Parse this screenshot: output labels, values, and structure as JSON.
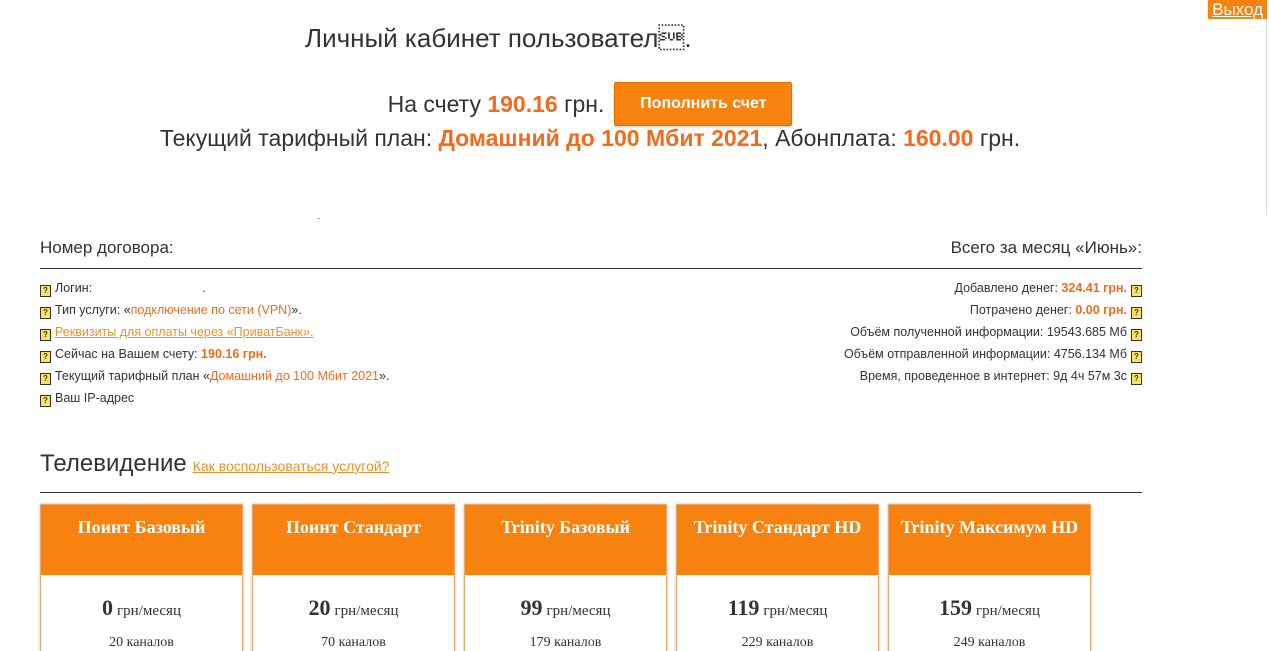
{
  "logout_label": "Выход",
  "header": {
    "title": "Личный кабинет пользовател\u001a.",
    "balance_prefix": "На счету",
    "balance_value": "190.16",
    "balance_unit": "грн.",
    "topup_label": "Пополнить счет",
    "plan_prefix": "Текущий тарифный план:",
    "plan_name": "Домашний до 100 Мбит 2021",
    "fee_prefix": ", Абонплата:",
    "fee_value": "160.00",
    "fee_unit": "грн."
  },
  "contract": {
    "heading_left": "Номер договора:",
    "heading_right": "Всего за месяц «Июнь»:",
    "left_rows": {
      "login_label": "Логин:",
      "login_value": ".",
      "service_label": "Тип услуги: «",
      "service_value": "подключение по сети (VPN)",
      "service_suffix": "».",
      "requisites_link": "Реквизиты для оплаты через «ПриватБанк».",
      "account_label": "Сейчас на Вашем счету:",
      "account_value": "190.16 грн.",
      "plan_label": "Текущий тарифный план «",
      "plan_value": "Домашний до 100 Мбит 2021",
      "plan_suffix": "».",
      "ip_label": "Ваш IP-адрес"
    },
    "right_rows": {
      "added_label": "Добавлено денег:",
      "added_value": "324.41 грн.",
      "spent_label": "Потрачено денег:",
      "spent_value": "0.00 грн.",
      "received_label": "Объём полученной информации: 19543.685 Мб",
      "sent_label": "Объём отправленной информации: 4756.134 Мб",
      "time_label": "Время, проведенное в интернет: 9д 4ч 57м 3с"
    },
    "help_glyph": "?"
  },
  "tv": {
    "title": "Телевидение",
    "help_link": "Как воспользоваться услугой?",
    "unit": "грн/месяц",
    "cards": [
      {
        "name": "Поинт Базовый",
        "price": "0",
        "channels": "20 каналов"
      },
      {
        "name": "Поинт Стандарт",
        "price": "20",
        "channels": "70 каналов"
      },
      {
        "name": "Trinity Базовый",
        "price": "99",
        "channels": "179 каналов"
      },
      {
        "name": "Trinity Стандарт HD",
        "price": "119",
        "channels": "229 каналов"
      },
      {
        "name": "Trinity Максимум HD",
        "price": "159",
        "channels": "249 каналов"
      }
    ]
  }
}
